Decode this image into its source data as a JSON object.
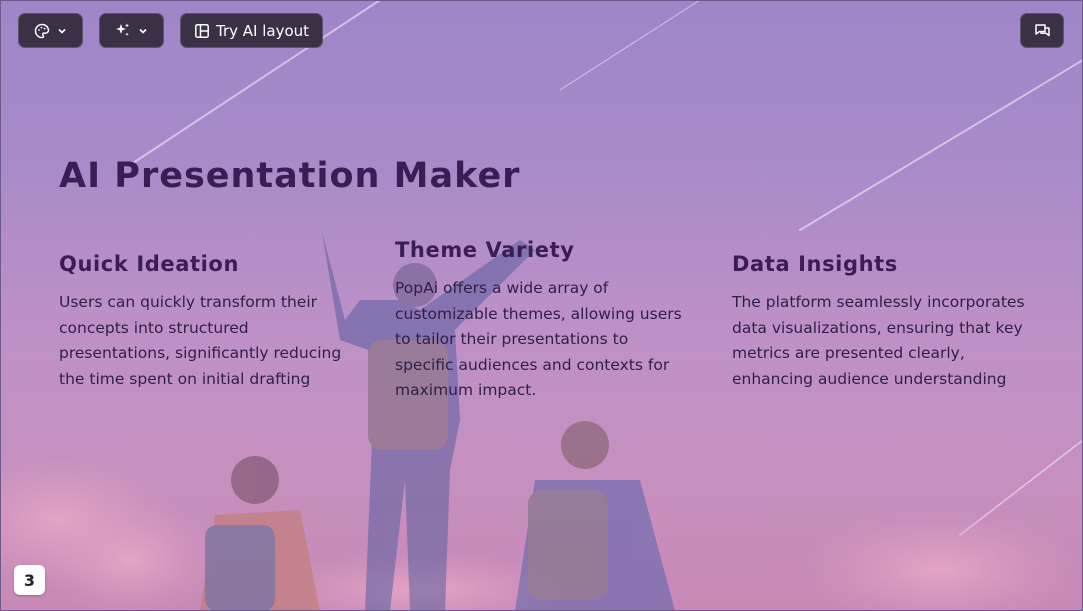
{
  "toolbar": {
    "theme_icon": "palette-icon",
    "ai_icon": "sparkles-icon",
    "layout_icon": "layout-icon",
    "layout_label": "Try AI layout",
    "chat_icon": "chat-icon"
  },
  "slide": {
    "title": "AI Presentation Maker",
    "columns": [
      {
        "heading": "Quick Ideation",
        "body": "Users can quickly transform their concepts into structured presentations, significantly reducing the time spent on initial drafting"
      },
      {
        "heading": "Theme Variety",
        "body": "PopAi offers a wide array of customizable themes, allowing users to tailor their presentations to specific audiences and contexts for maximum impact."
      },
      {
        "heading": "Data Insights",
        "body": "The platform seamlessly incorporates data visualizations, ensuring that key metrics are presented clearly, enhancing audience understanding"
      }
    ]
  },
  "page_number": "3",
  "colors": {
    "heading": "#3b1d56",
    "toolbar_bg": "#3a3147"
  }
}
